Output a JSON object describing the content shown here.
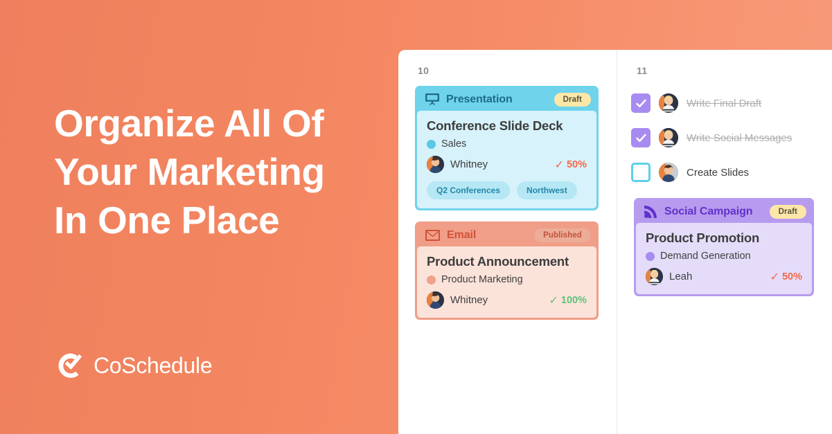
{
  "hero": {
    "title_lines": [
      "Organize All Of",
      "Your Marketing",
      "In One Place"
    ],
    "logo_text": "CoSchedule",
    "logo_icon": "coschedule-check-circle-icon",
    "background_color": "#f2855f",
    "text_color": "#ffffff"
  },
  "panel": {
    "columns": [
      {
        "date": "10",
        "cards": [
          {
            "theme": "presentation",
            "type_label": "Presentation",
            "type_icon": "presentation-screen-icon",
            "badge": "Draft",
            "title": "Conference Slide Deck",
            "category": "Sales",
            "category_color": "#58c8e6",
            "owner": "Whitney",
            "owner_avatar": "avatar-whitney",
            "progress": "50%",
            "progress_color": "#f4684a",
            "tags": [
              "Q2 Conferences",
              "Northwest"
            ]
          },
          {
            "theme": "email",
            "type_label": "Email",
            "type_icon": "envelope-icon",
            "badge": "Published",
            "title": "Product Announcement",
            "category": "Product Marketing",
            "category_color": "#f0a28c",
            "owner": "Whitney",
            "owner_avatar": "avatar-whitney",
            "progress": "100%",
            "progress_color": "#63c07c",
            "tags": []
          }
        ],
        "tasks": []
      },
      {
        "date": "11",
        "tasks": [
          {
            "label": "Write Final Draft",
            "checked": true,
            "avatar": "avatar-leah"
          },
          {
            "label": "Write Social Messages",
            "checked": true,
            "avatar": "avatar-leah"
          },
          {
            "label": "Create Slides",
            "checked": false,
            "avatar": "avatar-whitney"
          }
        ],
        "cards": [
          {
            "theme": "social",
            "type_label": "Social Campaign",
            "type_icon": "rss-broadcast-icon",
            "badge": "Draft",
            "title": "Product Promotion",
            "category": "Demand Generation",
            "category_color": "#a78bf0",
            "owner": "Leah",
            "owner_avatar": "avatar-leah",
            "progress": "50%",
            "progress_color": "#f4684a",
            "tags": []
          }
        ]
      }
    ],
    "checkbox_checked_color": "#a78bf0",
    "checkbox_unchecked_border": "#5bd0ea"
  }
}
